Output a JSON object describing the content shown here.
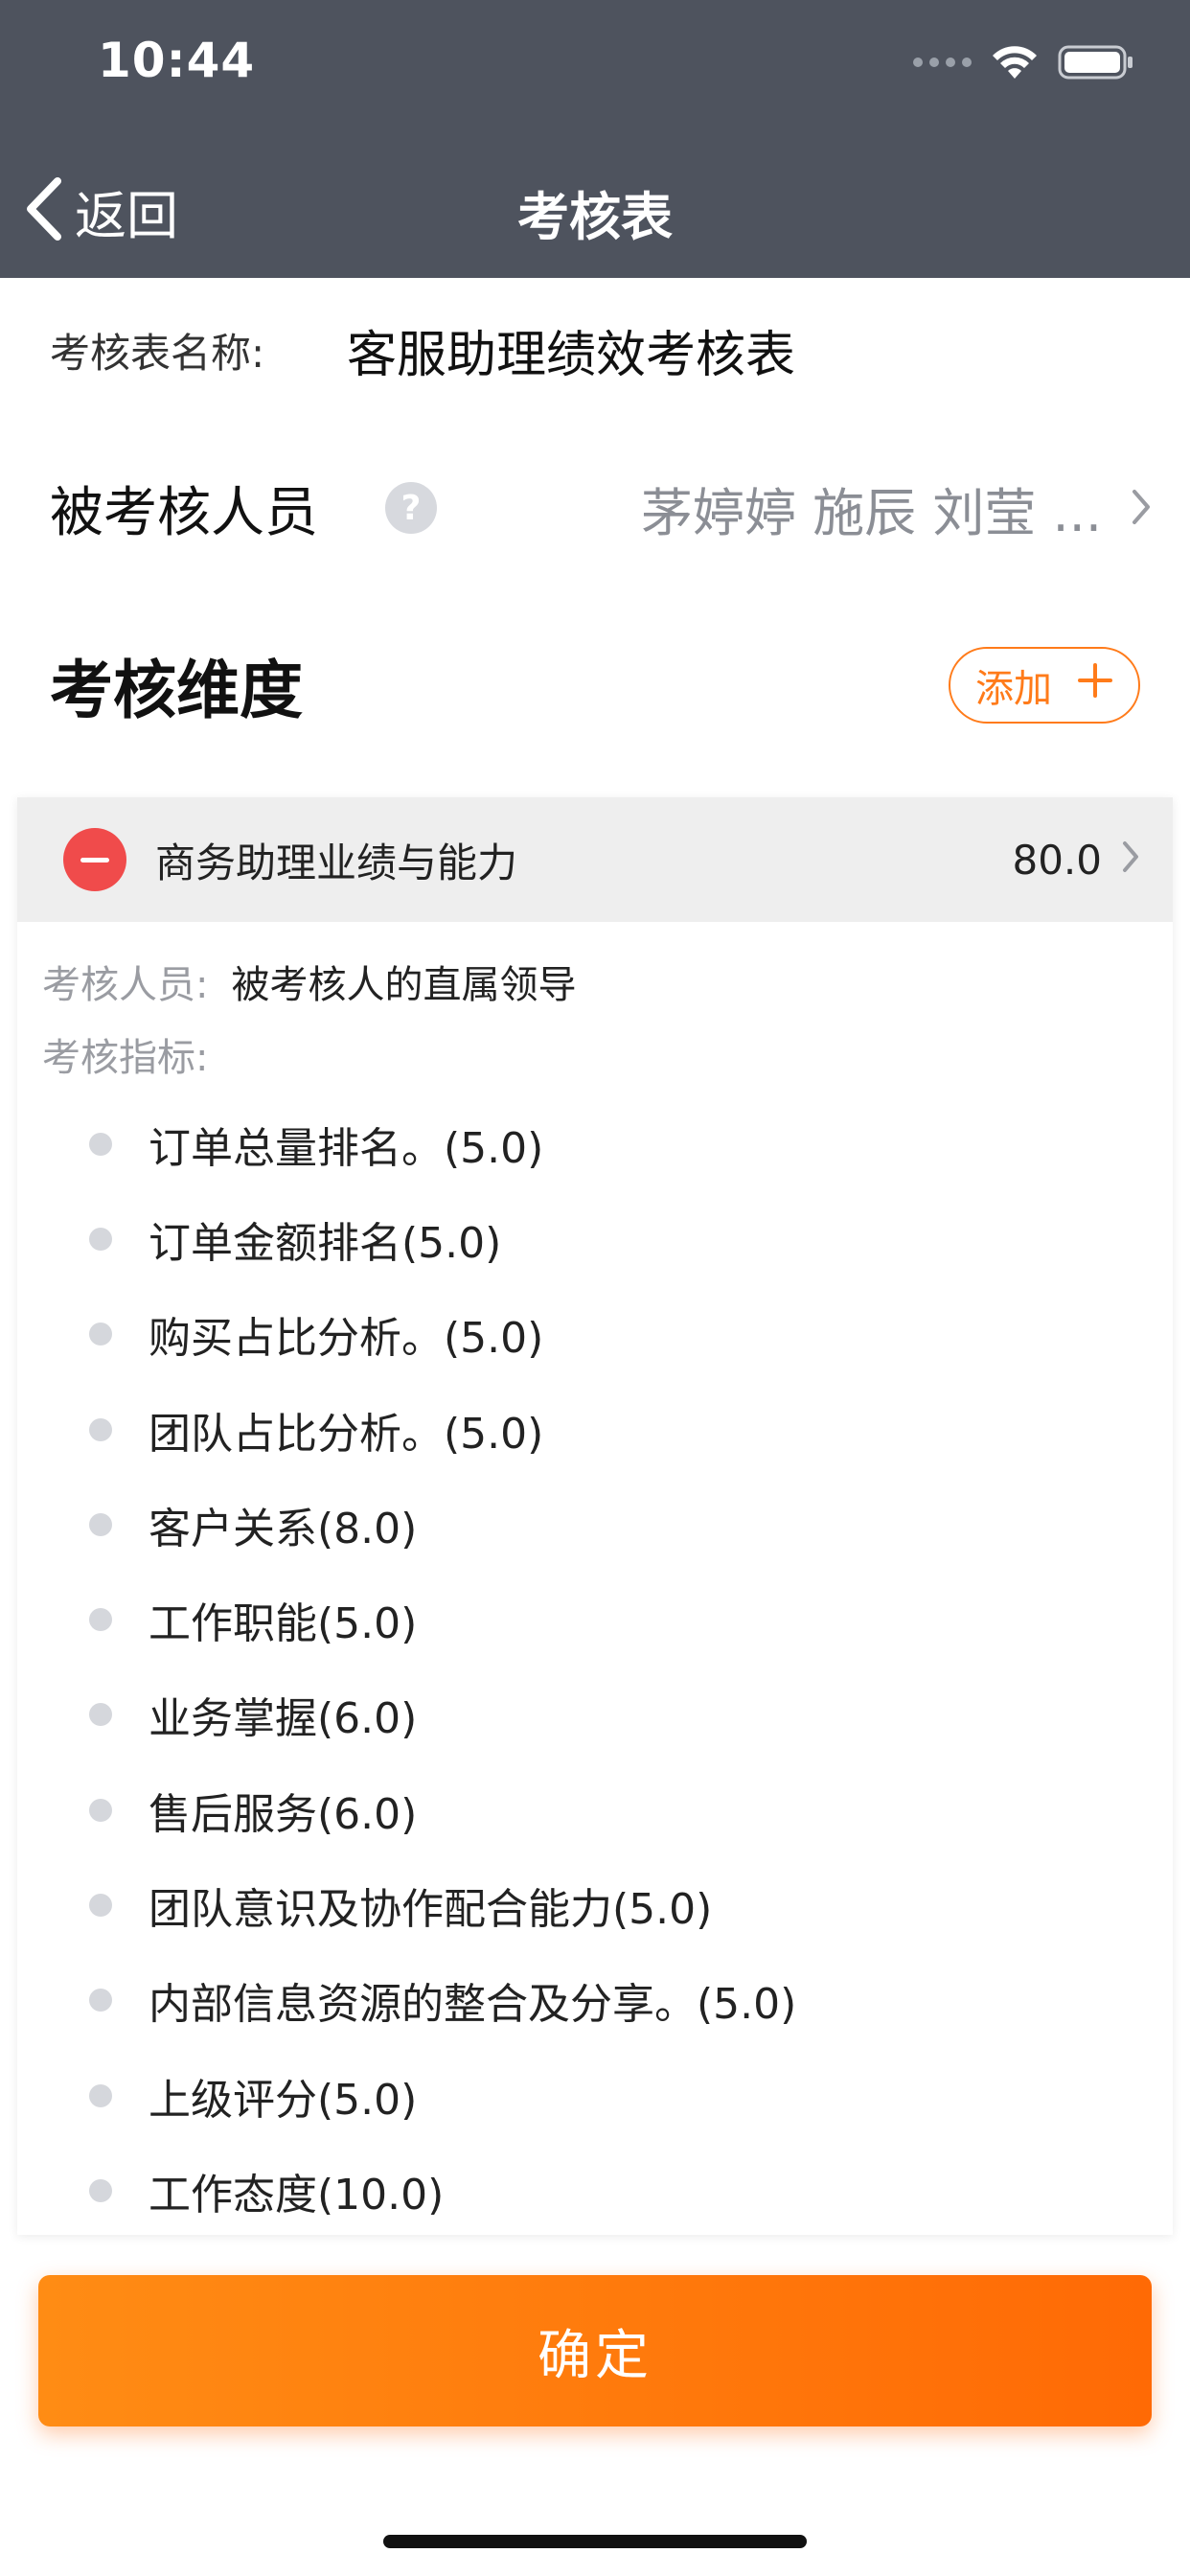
{
  "status": {
    "time": "10:44"
  },
  "nav": {
    "back_label": "返回",
    "title": "考核表"
  },
  "form": {
    "name_label": "考核表名称:",
    "name_value": "客服助理绩效考核表",
    "people_label": "被考核人员",
    "help_glyph": "?",
    "people_value": "茅婷婷 施辰 刘莹 ..."
  },
  "dimensions": {
    "title": "考核维度",
    "add_label": "添加"
  },
  "card": {
    "name": "商务助理业绩与能力",
    "score": "80.0",
    "reviewer_label": "考核人员:",
    "reviewer_value": "被考核人的直属领导",
    "indicators_label": "考核指标:",
    "indicators": [
      "订单总量排名。(5.0)",
      "订单金额排名(5.0)",
      "购买占比分析。(5.0)",
      "团队占比分析。(5.0)",
      "客户关系(8.0)",
      "工作职能(5.0)",
      "业务掌握(6.0)",
      "售后服务(6.0)",
      "团队意识及协作配合能力(5.0)",
      "内部信息资源的整合及分享。(5.0)",
      "上级评分(5.0)",
      "工作态度(10.0)"
    ]
  },
  "confirm_label": "确定",
  "colors": {
    "nav_bg": "#4e535e",
    "accent": "#ff7b1a",
    "remove": "#f04b4b"
  }
}
